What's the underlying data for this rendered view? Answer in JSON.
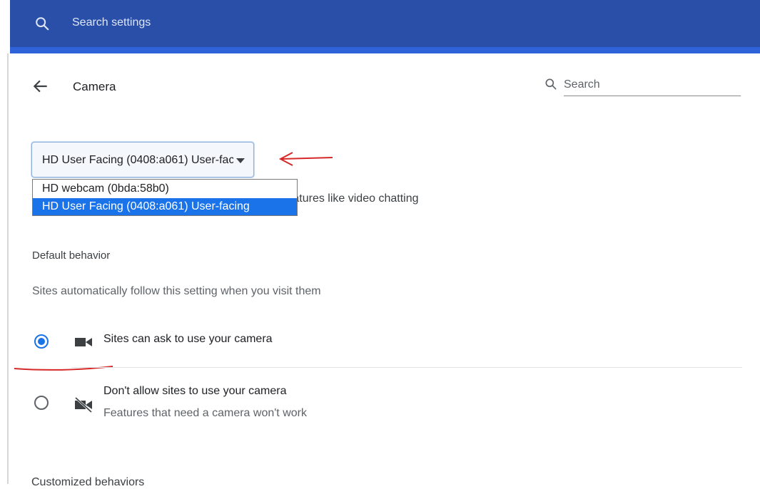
{
  "topbar": {
    "search_placeholder": "Search settings",
    "icon": "search-icon",
    "bg_color": "#2a4fa8"
  },
  "header": {
    "back_icon": "arrow-left-icon",
    "title": "Camera",
    "search_placeholder": "Search"
  },
  "device_select": {
    "selected_value": "HD User Facing (0408:a061) User-facing",
    "options": [
      "HD webcam (0bda:58b0)",
      "HD User Facing (0408:a061) User-facing"
    ],
    "highlighted_index": 1
  },
  "description": "Sites usually use your camera for communication features like video chatting",
  "default_behavior": {
    "heading": "Default behavior",
    "subtitle": "Sites automatically follow this setting when you visit them",
    "options": [
      {
        "label": "Sites can ask to use your camera",
        "icon": "camera-icon",
        "selected": true
      },
      {
        "label": "Don't allow sites to use your camera",
        "sublabel": "Features that need a camera won't work",
        "icon": "camera-off-icon",
        "selected": false
      }
    ]
  },
  "next_section": {
    "heading": "Customized behaviors"
  },
  "colors": {
    "accent": "#1a73e8",
    "annotation": "#d62828"
  }
}
